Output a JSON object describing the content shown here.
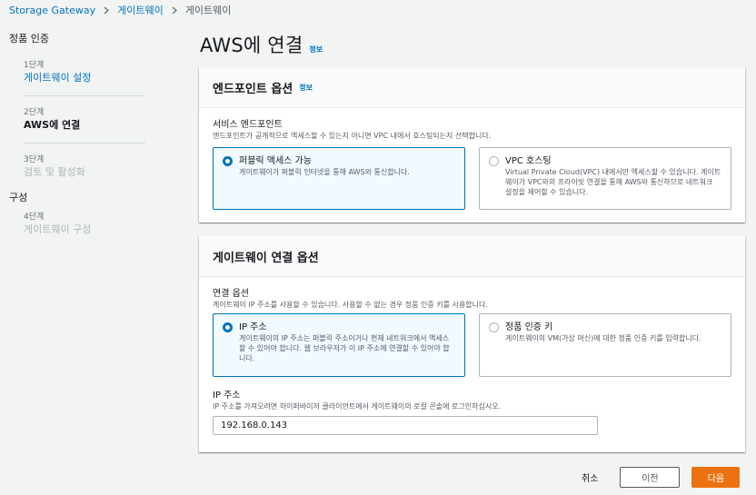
{
  "breadcrumb": [
    "Storage Gateway",
    "게이트웨이",
    "게이트웨이"
  ],
  "steps": {
    "section1": "정품 인증",
    "section2": "구성",
    "items": [
      {
        "num": "1단계",
        "name": "게이트웨이 설정"
      },
      {
        "num": "2단계",
        "name": "AWS에 연결"
      },
      {
        "num": "3단계",
        "name": "검토 및 활성화"
      },
      {
        "num": "4단계",
        "name": "게이트웨이 구성"
      }
    ]
  },
  "page": {
    "title": "AWS에 연결",
    "info": "정보"
  },
  "endpoint": {
    "header": "엔드포인트 옵션",
    "info": "정보",
    "label": "서비스 엔드포인트",
    "desc": "엔드포인트가 공개적으로 액세스할 수 있는지 아니면 VPC 내에서 호스팅되는지 선택합니다.",
    "options": [
      {
        "title": "퍼블릭 액세스 가능",
        "desc": "게이트웨이가 퍼블릭 인터넷을 통해 AWS와 통신합니다.",
        "selected": true
      },
      {
        "title": "VPC 호스팅",
        "desc": "Virtual Private Cloud(VPC) 내에서만 액세스할 수 있습니다. 게이트웨이가 VPC와의 프라이빗 연결을 통해 AWS와 통신하므로 네트워크 설정을 제어할 수 있습니다.",
        "selected": false
      }
    ]
  },
  "connection": {
    "header": "게이트웨이 연결 옵션",
    "label": "연결 옵션",
    "desc": "게이트웨이 IP 주소를 사용할 수 있습니다. 사용할 수 없는 경우 정품 인증 키를 사용합니다.",
    "options": [
      {
        "title": "IP 주소",
        "desc": "게이트웨이의 IP 주소는 퍼블릭 주소이거나 현재 네트워크에서 액세스할 수 있어야 합니다. 웹 브라우저가 이 IP 주소에 연결할 수 있어야 합니다.",
        "selected": true
      },
      {
        "title": "정품 인증 키",
        "desc": "게이트웨이의 VM(가상 머신)에 대한 정품 인증 키를 입력합니다.",
        "selected": false
      }
    ],
    "ip_label": "IP 주소",
    "ip_desc": "IP 주소를 가져오려면 하이퍼바이저 클라이언트에서 게이트웨이의 로컬 콘솔에 로그인하십시오.",
    "ip_value": "192.168.0.143"
  },
  "footer": {
    "cancel": "취소",
    "previous": "이전",
    "next": "다음"
  },
  "colors": {
    "accent": "#0073bb",
    "primary_button": "#ec7211",
    "background": "#f2f3f3"
  }
}
